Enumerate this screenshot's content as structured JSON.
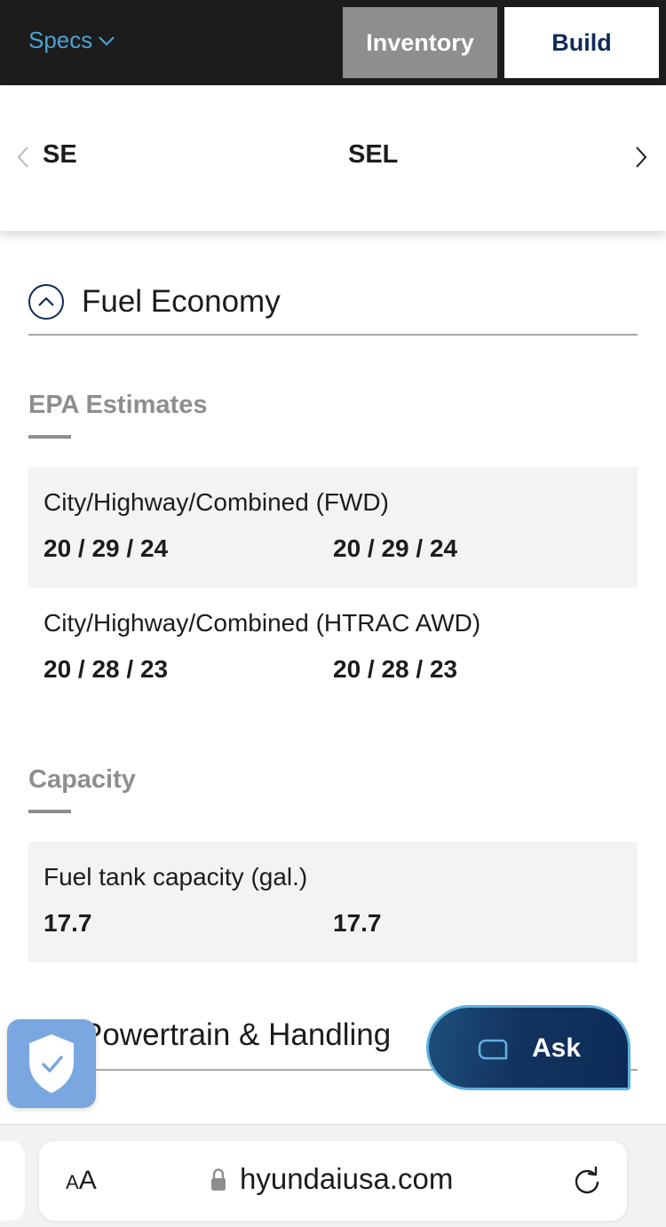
{
  "topbar": {
    "specs_label": "Specs",
    "inventory_label": "Inventory",
    "build_label": "Build"
  },
  "trims": {
    "left": "SE",
    "right": "SEL"
  },
  "fuel_economy": {
    "title": "Fuel Economy",
    "epa": {
      "title": "EPA Estimates",
      "rows": [
        {
          "label": "City/Highway/Combined (FWD)",
          "se": "20 / 29 / 24",
          "sel": "20 / 29 / 24"
        },
        {
          "label": "City/Highway/Combined (HTRAC AWD)",
          "se": "20 / 28 / 23",
          "sel": "20 / 28 / 23"
        }
      ]
    },
    "capacity": {
      "title": "Capacity",
      "rows": [
        {
          "label": "Fuel tank capacity (gal.)",
          "se": "17.7",
          "sel": "17.7"
        }
      ]
    }
  },
  "powertrain": {
    "title": "Powertrain & Handling"
  },
  "ask": {
    "label": "Ask"
  },
  "browser": {
    "aa_large": "A",
    "aa_small": "A",
    "url": "hyundaiusa.com"
  },
  "colors": {
    "nav_bg": "#1c1c1c",
    "specs_link": "#4aa3d4",
    "inventory_bg": "#8e8e8e",
    "brand_navy": "#0d2a57",
    "row_shade": "#f4f3f2",
    "shield_badge": "#7aa7e0"
  },
  "icons": [
    "chevron-down-icon",
    "chevron-left-icon",
    "chevron-right-icon",
    "chevron-up-icon",
    "shield-check-icon",
    "chat-bubble-icon",
    "lock-icon",
    "reload-icon"
  ]
}
